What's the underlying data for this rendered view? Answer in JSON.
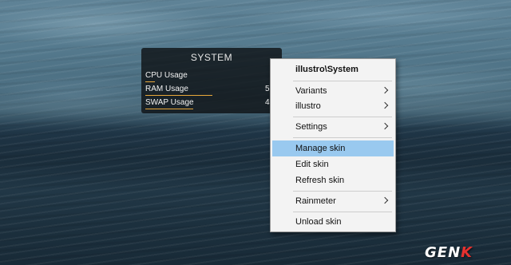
{
  "skin": {
    "title": "SYSTEM",
    "rows": [
      {
        "label": "CPU Usage",
        "value": ""
      },
      {
        "label": "RAM Usage",
        "value": "5"
      },
      {
        "label": "SWAP Usage",
        "value": "4"
      }
    ],
    "bar_color": "#e8a83a"
  },
  "context_menu": {
    "header": "illustro\\System",
    "items": [
      {
        "label": "Variants",
        "submenu": true
      },
      {
        "label": "illustro",
        "submenu": true
      },
      {
        "label": "Settings",
        "submenu": true
      },
      {
        "label": "Manage skin",
        "submenu": false,
        "highlighted": true
      },
      {
        "label": "Edit skin",
        "submenu": false
      },
      {
        "label": "Refresh skin",
        "submenu": false
      },
      {
        "label": "Rainmeter",
        "submenu": true
      },
      {
        "label": "Unload skin",
        "submenu": false
      }
    ],
    "highlight_color": "#99c9ef"
  },
  "watermark": {
    "text_main": "GEN",
    "text_accent": "K"
  }
}
